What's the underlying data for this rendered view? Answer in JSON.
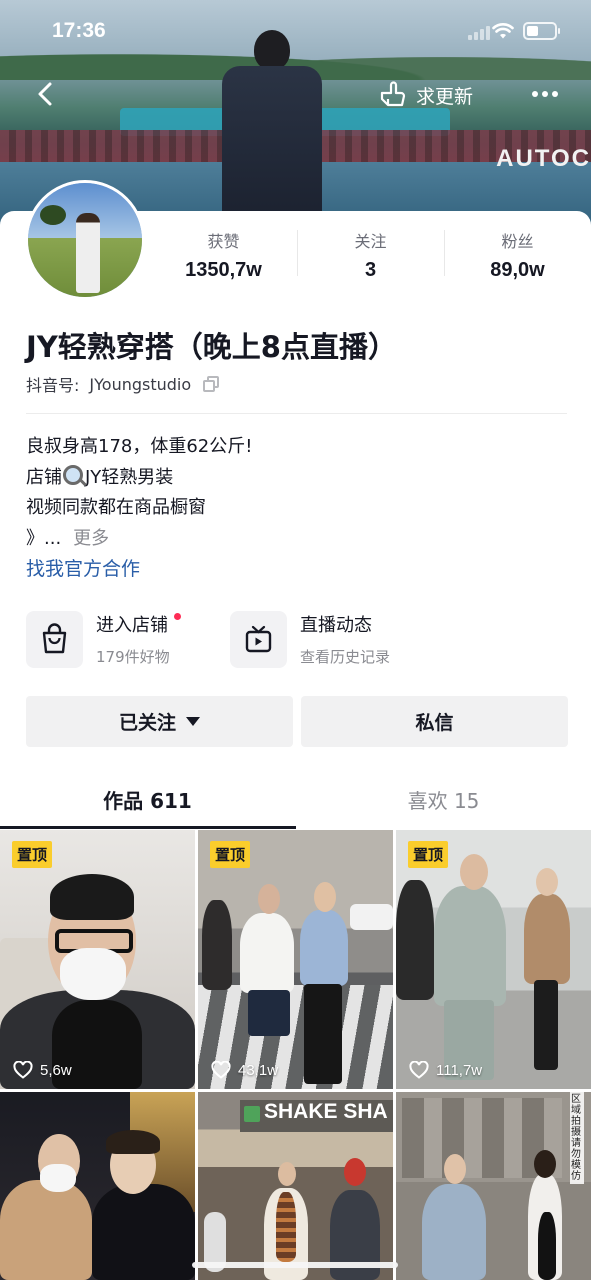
{
  "status_bar": {
    "time": "17:36"
  },
  "cover": {
    "sign_text": "AUTOC"
  },
  "nav": {
    "update_label": "求更新"
  },
  "profile": {
    "name": "JY轻熟穿搭（晚上8点直播）",
    "id_label": "抖音号:",
    "id_value": "JYoungstudio",
    "stats": [
      {
        "label": "获赞",
        "value": "1350,7w"
      },
      {
        "label": "关注",
        "value": "3"
      },
      {
        "label": "粉丝",
        "value": "89,0w"
      }
    ],
    "bio": {
      "line1": "良叔身高178，体重62公斤!",
      "line2_pre": "店铺",
      "line2_post": "JY轻熟男装",
      "line3": "视频同款都在商品橱窗",
      "line4": "》...",
      "more": "更多"
    },
    "cooperation": "找我官方合作"
  },
  "entries": {
    "shop": {
      "title": "进入店铺",
      "subtitle": "179件好物"
    },
    "live": {
      "title": "直播动态",
      "subtitle": "查看历史记录"
    }
  },
  "buttons": {
    "following": "已关注",
    "message": "私信"
  },
  "tabs": {
    "works": "作品 611",
    "likes": "喜欢 15"
  },
  "grid": {
    "pinned_label": "置顶",
    "tiles": [
      {
        "likes": "5,6w",
        "pinned": true
      },
      {
        "likes": "43,1w",
        "pinned": true
      },
      {
        "likes": "111,7w",
        "pinned": true
      },
      {
        "likes": "",
        "pinned": false
      },
      {
        "likes": "",
        "pinned": false
      },
      {
        "likes": "",
        "pinned": false
      }
    ],
    "shake_sign": "SHAKE SHA",
    "side_text": "区域拍摄请勿模仿"
  },
  "colors": {
    "accent_red": "#fe2c55",
    "pin_yellow": "#facd2c",
    "link_blue": "#2a5ea8"
  }
}
